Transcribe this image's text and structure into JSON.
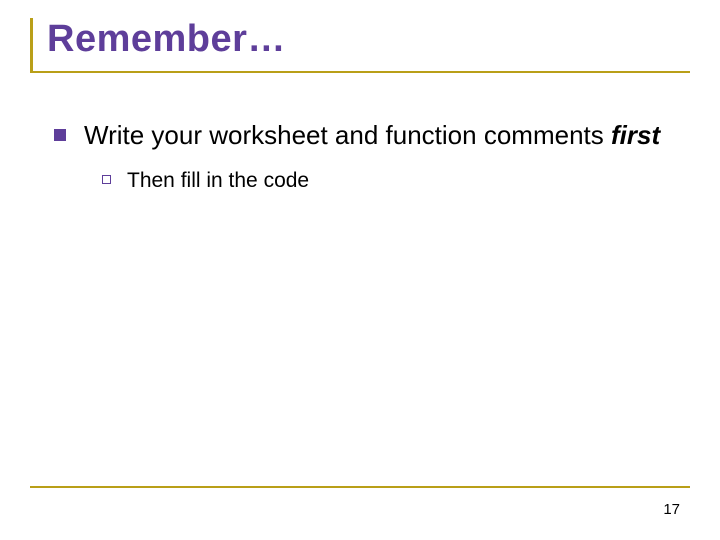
{
  "title": "Remember…",
  "body": {
    "point1": {
      "text_prefix": "Write your worksheet and function comments ",
      "emph": "first",
      "sub1": "Then fill in the code"
    }
  },
  "page_number": "17"
}
